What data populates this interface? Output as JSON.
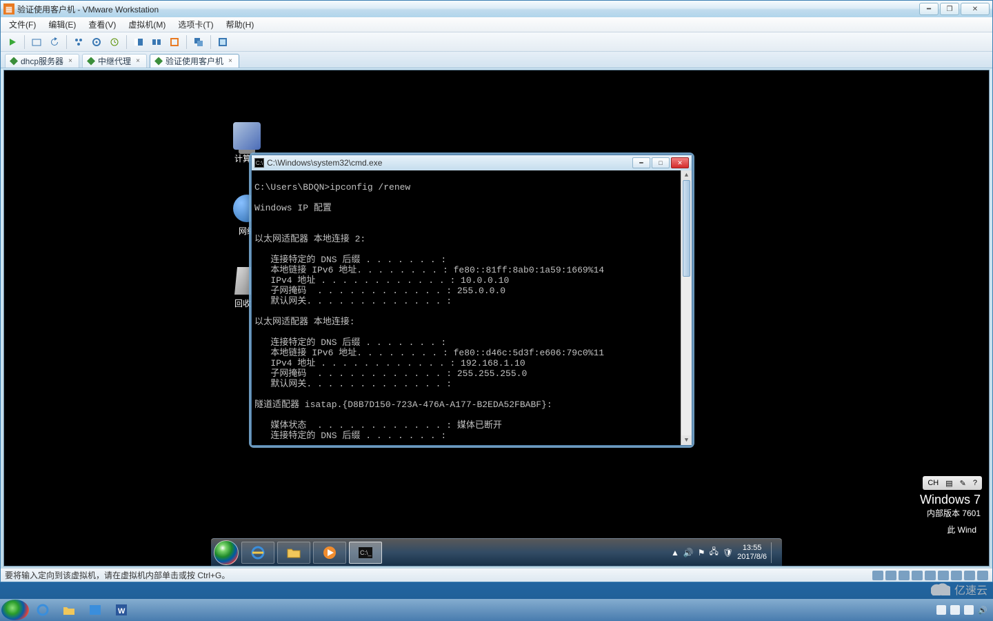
{
  "host": {
    "title": "验证使用客户机 - VMware Workstation",
    "menus": [
      "文件(F)",
      "编辑(E)",
      "查看(V)",
      "虚拟机(M)",
      "选项卡(T)",
      "帮助(H)"
    ],
    "tabs": [
      "dhcp服务器",
      "中继代理",
      "验证使用客户机"
    ],
    "active_tab_index": 2,
    "statusbar": "要将输入定向到该虚拟机，请在虚拟机内部单击或按 Ctrl+G。"
  },
  "guest": {
    "desktop_icons": {
      "computer": "计算机",
      "network": "网络",
      "recycle": "回收站"
    },
    "brand_main": "Windows 7",
    "brand_sub": "内部版本 7601",
    "brand_hint": "此 Wind",
    "cmd": {
      "title": "C:\\Windows\\system32\\cmd.exe",
      "lines": [
        "C:\\Users\\BDQN>ipconfig /renew",
        "",
        "Windows IP 配置",
        "",
        "",
        "以太网适配器 本地连接 2:",
        "",
        "   连接特定的 DNS 后缀 . . . . . . . :",
        "   本地链接 IPv6 地址. . . . . . . . : fe80::81ff:8ab0:1a59:1669%14",
        "   IPv4 地址 . . . . . . . . . . . . : 10.0.0.10",
        "   子网掩码  . . . . . . . . . . . . : 255.0.0.0",
        "   默认网关. . . . . . . . . . . . . :",
        "",
        "以太网适配器 本地连接:",
        "",
        "   连接特定的 DNS 后缀 . . . . . . . :",
        "   本地链接 IPv6 地址. . . . . . . . : fe80::d46c:5d3f:e606:79c0%11",
        "   IPv4 地址 . . . . . . . . . . . . : 192.168.1.10",
        "   子网掩码  . . . . . . . . . . . . : 255.255.255.0",
        "   默认网关. . . . . . . . . . . . . :",
        "",
        "隧道适配器 isatap.{D8B7D150-723A-476A-A177-B2EDA52FBABF}:",
        "",
        "   媒体状态  . . . . . . . . . . . . : 媒体已断开",
        "   连接特定的 DNS 后缀 . . . . . . . :"
      ]
    },
    "lang_bar": {
      "ime": "CH",
      "glyph": "▤",
      "help": "?"
    },
    "clock": {
      "time": "13:55",
      "date": "2017/8/6"
    }
  },
  "watermark": "亿速云"
}
